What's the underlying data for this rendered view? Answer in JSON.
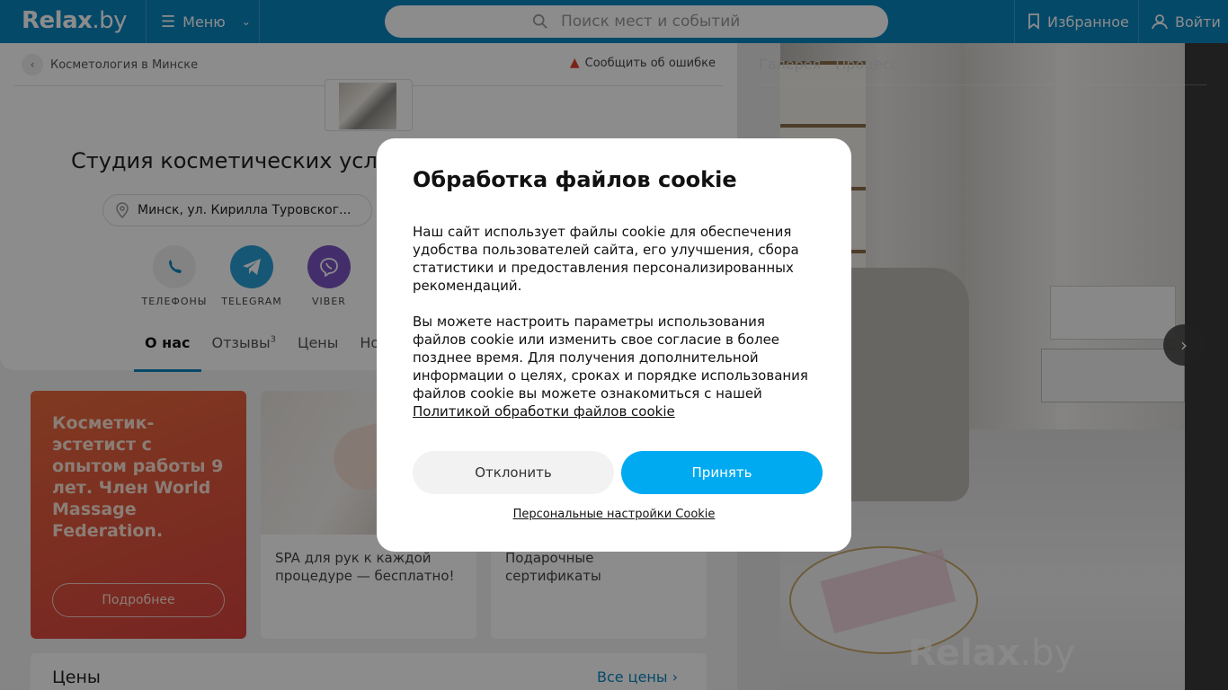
{
  "header": {
    "logo_main": "Relax",
    "logo_tld": ".by",
    "menu_label": "Меню",
    "search_placeholder": "Поиск мест и событий",
    "favorites_label": "Избранное",
    "login_label": "Войти"
  },
  "place": {
    "breadcrumb": "Косметология в Минске",
    "report_label": "Сообщить об ошибке",
    "title": "Студия косметических усл",
    "address": "Минск, ул. Кирилла Туровског...",
    "contacts": [
      {
        "label": "ТЕЛЕФОНЫ",
        "icon": "phone-icon",
        "color": "#eeeeee"
      },
      {
        "label": "TELEGRAM",
        "icon": "telegram-icon",
        "color": "#2a9fd8"
      },
      {
        "label": "VIBER",
        "icon": "viber-icon",
        "color": "#7a55c4"
      }
    ],
    "tabs": [
      {
        "label": "О нас",
        "active": true
      },
      {
        "label": "Отзывы",
        "sup": "3"
      },
      {
        "label": "Цены"
      },
      {
        "label": "Нов"
      }
    ]
  },
  "promos": {
    "red_text": "Косметик-эстетист с опытом работы 9 лет. Член World Massage Federation.",
    "red_more": "Подробнее",
    "spa_caption": "SPA для рук к каждой процедуре — бесплатно!",
    "gift_caption": "Подарочные сертификаты"
  },
  "prices": {
    "title": "Цены",
    "all_label": "Все цены"
  },
  "gallery": {
    "tab1": "Галерея",
    "tab2": "Процесс",
    "watermark_main": "Relax",
    "watermark_tld": ".by"
  },
  "cookie": {
    "title": "Обработка файлов cookie",
    "para1": "Наш сайт использует файлы cookie для обеспечения удобства пользователей сайта, его улучшения, сбора статистики и предоставления персонализированных рекомендаций.",
    "para2": "Вы можете настроить параметры использования файлов cookie или изменить свое согласие в более позднее время. Для получения дополнительной информации о целях, сроках и порядке использования файлов cookie вы можете ознакомиться с нашей",
    "policy_link": "Политикой обработки файлов cookie",
    "decline": "Отклонить",
    "accept": "Принять",
    "personal": "Персональные настройки Cookie"
  },
  "colors": {
    "brand": "#0a86c0",
    "accept": "#00aaf0"
  }
}
